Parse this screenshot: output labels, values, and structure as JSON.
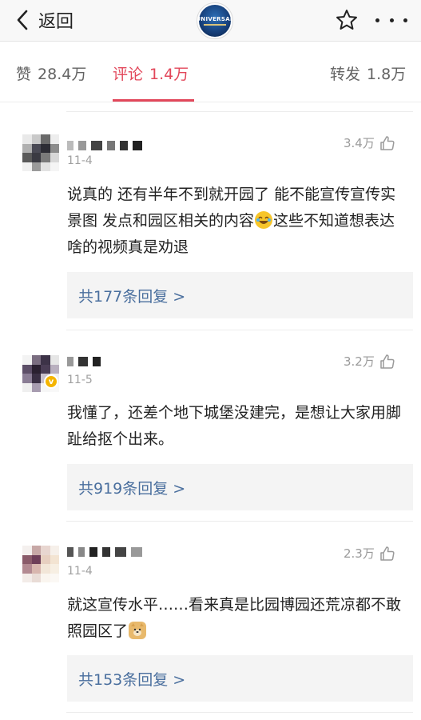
{
  "header": {
    "back_label": "返回",
    "logo_text": "UNIVERSAL",
    "icons": {
      "back": "chevron-left-icon",
      "favorite": "star-icon",
      "more": "more-horizontal-icon"
    }
  },
  "tabs": [
    {
      "label": "赞",
      "count": "28.4万",
      "active": false
    },
    {
      "label": "评论",
      "count": "1.4万",
      "active": true
    },
    {
      "label": "转发",
      "count": "1.8万",
      "active": false
    }
  ],
  "colors": {
    "accent": "#e2475a",
    "link": "#4a6f9e",
    "reply_bg": "#f4f4f4",
    "verified": "#f4b400"
  },
  "comments": [
    {
      "date": "11-4",
      "likes": "3.4万",
      "text_before": "说真的 还有半年不到就开园了 能不能宣传宣传实景图 发点和园区相关的内容",
      "emoji": "laughing-tears-emoji",
      "text_after": "这些不知道想表达啥的视频真是劝退",
      "reply_label": "共177条回复 >",
      "verified": false
    },
    {
      "date": "11-5",
      "likes": "3.2万",
      "text_before": "我懂了，还差个地下城堡没建完，是想让大家用脚趾给抠个出来。",
      "emoji": "",
      "text_after": "",
      "reply_label": "共919条回复 >",
      "verified": true
    },
    {
      "date": "11-4",
      "likes": "2.3万",
      "text_before": "就这宣传水平……看来真是比园博园还荒凉都不敢照园区了",
      "emoji": "doge-emoji",
      "text_after": "",
      "reply_label": "共153条回复 >",
      "verified": false
    }
  ]
}
